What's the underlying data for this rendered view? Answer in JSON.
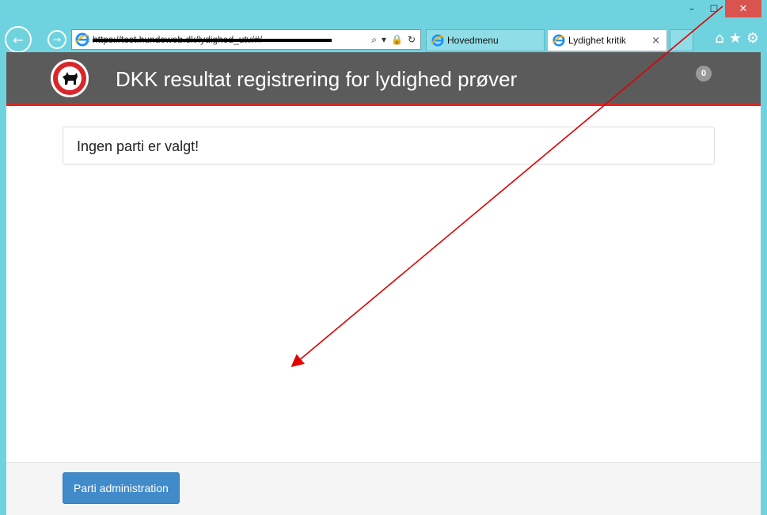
{
  "window": {
    "minimize_glyph": "–",
    "maximize_glyph": "☐",
    "close_glyph": "✕"
  },
  "browser": {
    "back_glyph": "←",
    "forward_glyph": "→",
    "address": "https://test.hundeweb.dk/lydighed_utv/#/",
    "address_icons": {
      "search": "⌕",
      "dropdown": "▾",
      "lock": "🔒",
      "refresh": "↻"
    },
    "tabs": [
      {
        "label": "Hovedmenu",
        "active": false
      },
      {
        "label": "Lydighet kritik",
        "active": true,
        "close_glyph": "×"
      }
    ],
    "toolbar": {
      "home_glyph": "⌂",
      "favorites_glyph": "★",
      "settings_glyph": "⚙"
    }
  },
  "header": {
    "title": "DKK resultat registrering for lydighed prøver",
    "badge_count": "0",
    "logo_icon": "dkk-logo-icon"
  },
  "main": {
    "panel_text": "Ingen parti er valgt!"
  },
  "footer": {
    "button_label": "Parti administration"
  },
  "colors": {
    "header_bg": "#5b5b5b",
    "header_border": "#e0261f",
    "button_primary": "#428bca",
    "window_frame": "#6fd3df",
    "annotation_arrow": "#e00000"
  }
}
